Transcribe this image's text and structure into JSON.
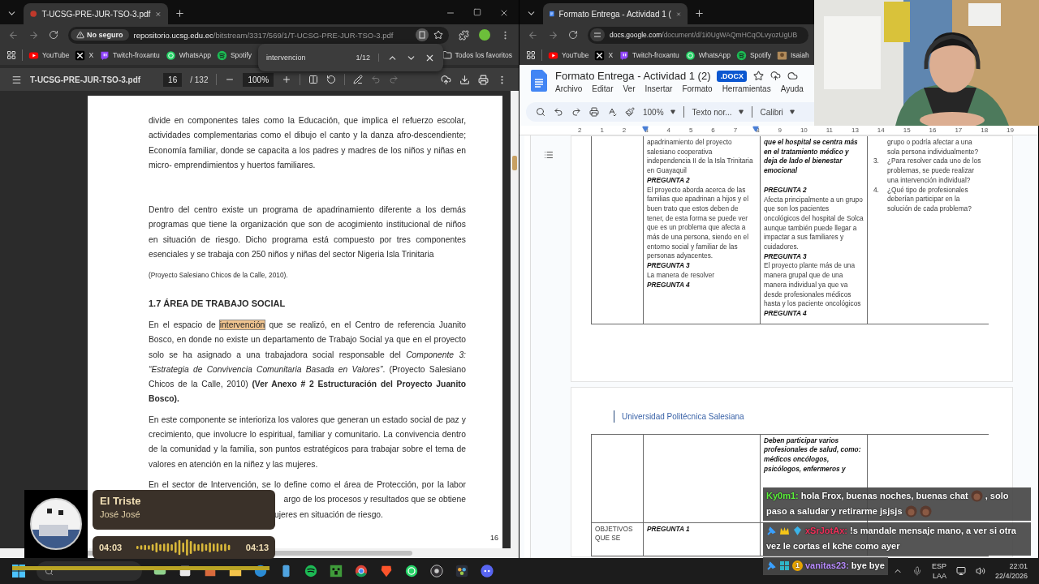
{
  "pdf_window": {
    "tab_title": "T-UCSG-PRE-JUR-TSO-3.pdf",
    "security": "No seguro",
    "url_host": "repositorio.ucsg.edu.ec",
    "url_path": "/bitstream/3317/569/1/T-UCSG-PRE-JUR-TSO-3.pdf",
    "bookmarks": [
      {
        "kind": "youtube",
        "label": "YouTube"
      },
      {
        "kind": "x",
        "label": "X"
      },
      {
        "kind": "twitch",
        "label": "Twitch-froxantu"
      },
      {
        "kind": "whatsapp",
        "label": "WhatsApp"
      },
      {
        "kind": "spotify",
        "label": "Spotify"
      }
    ],
    "all_bookmarks": "Todos los favoritos",
    "find_bar": {
      "query": "intervencion",
      "count": "1/12"
    },
    "pdf_toolbar": {
      "file_name": "T-UCSG-PRE-JUR-TSO-3.pdf",
      "page": "16",
      "page_total": "/ 132",
      "zoom": "100%"
    },
    "page": {
      "blocks": [
        {
          "kind": "paragraph",
          "parts": [
            {
              "text": "divide en componentes tales como la Educación, que implica el refuerzo escolar, actividades complementarias como el dibujo el canto y la danza afro-descendiente; Economía familiar, donde se capacita a los padres y madres de los niños y niñas en micro- emprendimientos y huertos familiares."
            }
          ]
        },
        {
          "kind": "paragraph",
          "parts": [
            {
              "text": "Dentro del centro existe un programa de apadrinamiento diferente a los demás programas que tiene la organización que son de acogimiento institucional de niños en situación de riesgo. Dicho programa está compuesto por tres componentes esenciales y  se trabaja con 250 niños y niñas del sector Nigeria Isla Trinitaria"
            }
          ]
        },
        {
          "kind": "citation",
          "parts": [
            {
              "text": "(Proyecto Salesiano Chicos de la Calle, 2010)."
            }
          ]
        },
        {
          "kind": "heading",
          "parts": [
            {
              "text": "1.7 ÁREA DE TRABAJO SOCIAL"
            }
          ]
        },
        {
          "kind": "paragraph",
          "parts": [
            {
              "text": "En el espacio de ",
              "highlighted": false
            },
            {
              "text": "intervención",
              "highlighted": true
            },
            {
              "text": " que se realizó, en el Centro de referencia Juanito Bosco, en donde no existe un departamento de Trabajo Social ya que en el proyecto solo se ha asignado a una trabajadora social responsable del *Componente 3: “Estrategia de Convivencia Comunitaria Basada en Valores”*. (Proyecto Salesiano Chicos de la Calle, 2010) **(Ver Anexo # 2 Estructuración del Proyecto Juanito Bosco).**",
              "highlighted": false
            }
          ]
        },
        {
          "kind": "paragraph",
          "parts": [
            {
              "text": "En este componente se interioriza los valores que generan un estado social de paz y crecimiento, que involucre lo espiritual, familiar y comunitario. La convivencia dentro de la comunidad y la familia, son puntos estratégicos para trabajar sobre el tema de valores en atención en la niñez y las mujeres."
            }
          ]
        },
        {
          "kind": "line",
          "parts": [
            {
              "text": "En el sector de Intervención, se lo define como el área de Protección, por la labor"
            }
          ]
        },
        {
          "kind": "fragment_end",
          "parts": [
            {
              "text": "argo de los procesos y resultados que se obtiene"
            }
          ]
        },
        {
          "kind": "fragment",
          "parts": [
            {
              "text": "ujeres en situación de riesgo."
            }
          ]
        }
      ],
      "page_number": "16"
    }
  },
  "docs_window": {
    "tab_title": "Formato Entrega - Actividad 1 (",
    "url_host": "docs.google.com",
    "url_path": "/document/d/1i0UgWAQmHCqOLvyozUgUB",
    "bookmarks": [
      {
        "kind": "youtube",
        "label": "YouTube"
      },
      {
        "kind": "x",
        "label": "X"
      },
      {
        "kind": "twitch",
        "label": "Twitch-froxantu"
      },
      {
        "kind": "whatsapp",
        "label": "WhatsApp"
      },
      {
        "kind": "spotify",
        "label": "Spotify"
      },
      {
        "kind": "thumbnail",
        "label": "Isaiah"
      }
    ],
    "doc_title": "Formato Entrega - Actividad 1 (2)",
    "badge": ".DOCX",
    "menu": [
      "Archivo",
      "Editar",
      "Ver",
      "Insertar",
      "Formato",
      "Herramientas",
      "Ayuda"
    ],
    "toolbar": {
      "zoom": "100%",
      "style": "Texto nor...",
      "font": "Calibri"
    },
    "ruler": [
      "2",
      "1",
      "2",
      "3",
      "4",
      "5",
      "6",
      "7",
      "8",
      "9",
      "10",
      "11",
      "13",
      "14",
      "15",
      "16",
      "17",
      "18",
      "19"
    ],
    "page_1_table": {
      "column_2": {
        "items": [
          {
            "kind": "answer",
            "text": "apadrinamiento del proyecto salesiano cooperativa independencia II de la Isla Trinitaria en Guayaquil"
          },
          {
            "kind": "question",
            "text": "PREGUNTA 2"
          },
          {
            "kind": "answer",
            "text": "El proyecto aborda acerca de las familias que apadrinan a hijos y el buen trato que estos deben de tener, de esta forma se puede ver que es un problema que afecta a más de una persona, siendo en el entorno social y familiar de las personas adyacentes."
          },
          {
            "kind": "question",
            "text": "PREGUNTA 3"
          },
          {
            "kind": "answer",
            "text": "La manera de resolver"
          },
          {
            "kind": "question",
            "text": "PREGUNTA 4"
          }
        ]
      },
      "column_3": {
        "items": [
          {
            "kind": "emphasis",
            "text": "que el hospital se centra más en el tratamiento médico y deja de lado el bienestar emocional"
          },
          {
            "kind": "question",
            "text": "PREGUNTA 2"
          },
          {
            "kind": "answer",
            "text": "Afecta principalmente a un grupo que son los pacientes oncológicos del hospital de Solca aunque también puede llegar a impactar a sus familiares y cuidadores."
          },
          {
            "kind": "question",
            "text": "PREGUNTA 3"
          },
          {
            "kind": "answer",
            "text": "El proyecto plante más de una manera grupal que de una manera individual ya que va desde profesionales médicos hasta y los paciente oncológicos"
          },
          {
            "kind": "question",
            "text": "PREGUNTA 4"
          }
        ]
      },
      "column_4": {
        "items": [
          {
            "kind": "continuation",
            "text": "grupo o podría afectar a una sola persona individualmente?"
          },
          {
            "kind": "item",
            "number": "3.",
            "text": "¿Para resolver cada uno de los problemas, se puede realizar una intervención individual?"
          },
          {
            "kind": "item",
            "number": "4.",
            "text": "¿Qué tipo de profesionales deberían participar en la solución de cada problema?"
          }
        ]
      }
    },
    "page_2": {
      "header": "Universidad Politécnica Salesiana",
      "rows": [
        {
          "column_3": {
            "items": [
              {
                "kind": "emphasis",
                "text": "Deben participar varios profesionales de salud, como: médicos oncólogos, psicólogos, enfermeros y"
              }
            ]
          }
        },
        {
          "column_1": {
            "items": [
              {
                "kind": "answer",
                "text": "OBJETIVOS QUE SE"
              }
            ]
          },
          "column_2": {
            "items": [
              {
                "kind": "question",
                "text": "PREGUNTA 1"
              }
            ]
          }
        }
      ]
    }
  },
  "now_playing": {
    "title": "El Triste",
    "artist": "José José",
    "elapsed": "04:03",
    "duration": "04:13",
    "level": 0.96
  },
  "chat": [
    {
      "user": "Ky0m1:",
      "color": "#5cf03c",
      "parts": [
        {
          "kind": "text",
          "text": "hola Frox, buenas noches, buenas chat"
        },
        {
          "kind": "emote"
        },
        {
          "kind": "text",
          "text": ", solo"
        },
        {
          "kind": "text",
          "text": "paso a saludar y retirarme jsjsjs"
        },
        {
          "kind": "emote"
        },
        {
          "kind": "emote"
        }
      ]
    },
    {
      "user": "xSrJotAx:",
      "color": "#f0305a",
      "badges": [
        {
          "kind": "pin"
        },
        {
          "kind": "crown"
        },
        {
          "kind": "gem"
        }
      ],
      "parts": [
        {
          "kind": "text",
          "text": "!s mandale mensaje mano, a ver si otra"
        },
        {
          "kind": "text",
          "text": "vez le cortas el kche como ayer"
        }
      ]
    },
    {
      "user": "vanitas23:",
      "color": "#b98cff",
      "badges": [
        {
          "kind": "pin"
        },
        {
          "kind": "grid"
        },
        {
          "kind": "count",
          "label": "1"
        }
      ],
      "parts": [
        {
          "kind": "text",
          "text": "bye bye"
        }
      ]
    }
  ],
  "taskbar": {
    "apps": [
      {
        "kind": "widget"
      },
      {
        "kind": "files"
      },
      {
        "kind": "store"
      },
      {
        "kind": "folder"
      },
      {
        "kind": "edge"
      },
      {
        "kind": "phone"
      },
      {
        "kind": "spotify"
      },
      {
        "kind": "minecraft"
      },
      {
        "kind": "chrome"
      },
      {
        "kind": "brave"
      },
      {
        "kind": "whatsapp"
      },
      {
        "kind": "obs"
      },
      {
        "kind": "davinci"
      },
      {
        "kind": "discord"
      }
    ],
    "language": "ESP",
    "layout": "LAA",
    "time": "22:01",
    "date": "22/4/2026"
  }
}
